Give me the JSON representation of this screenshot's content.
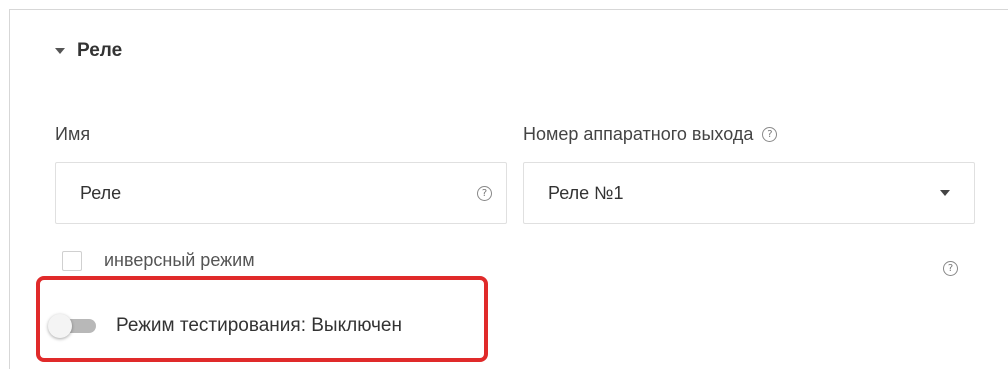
{
  "section": {
    "title": "Реле",
    "caret_icon": "caret-down-icon"
  },
  "fields": {
    "name": {
      "label": "Имя",
      "value": "Реле",
      "help_icon": "help-circle-icon"
    },
    "output": {
      "label": "Номер аппаратного выхода",
      "selected": "Реле №1",
      "help_icon": "help-circle-icon",
      "arrow_icon": "dropdown-arrow-icon"
    }
  },
  "inverse_mode": {
    "label": "инверсный режим",
    "checked": false,
    "help_icon": "help-circle-icon"
  },
  "test_mode": {
    "label": "Режим тестирования: Выключен",
    "enabled": false
  },
  "colors": {
    "highlight": "#e02a2a",
    "toggle_track_off": "#b8b8b8",
    "border": "#e0e0e0"
  },
  "help_glyph": "?"
}
